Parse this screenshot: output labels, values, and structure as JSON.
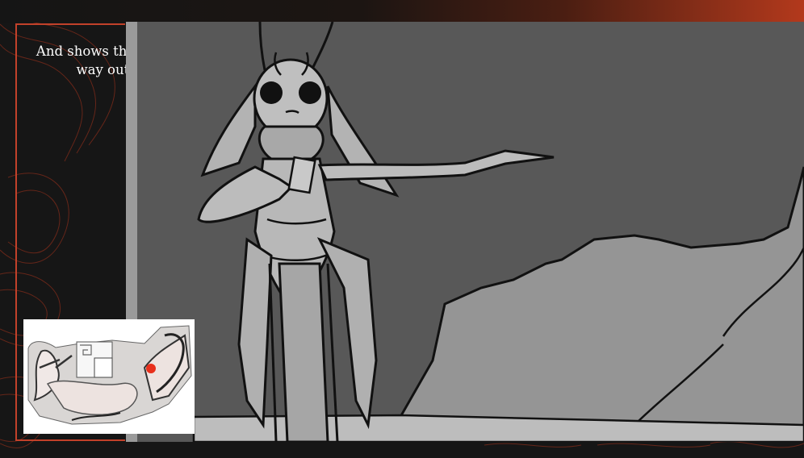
{
  "story": {
    "caption": "And shows them the way out."
  },
  "scene": {
    "illustration": "grayscale sketch of a tall insect-like creature pointing the way beside a rocky cliff"
  },
  "minimap": {
    "player_marker_color": "#e8301c"
  },
  "theme": {
    "accent": "#c2412a",
    "background": "#161616"
  }
}
